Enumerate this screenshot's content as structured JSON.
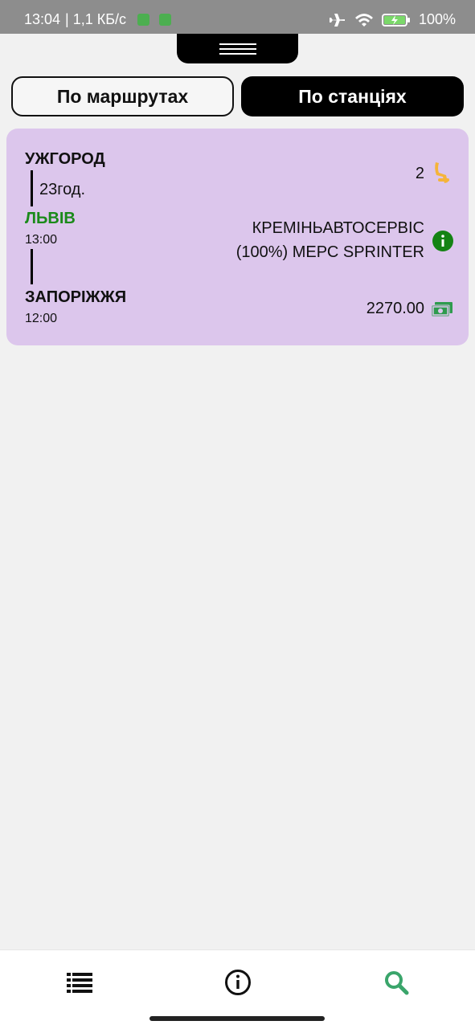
{
  "status_bar": {
    "time": "13:04",
    "speed": "| 1,1 КБ/с",
    "battery": "100%",
    "icons": [
      "app-icon",
      "app-icon",
      "airplane-icon",
      "wifi-icon",
      "battery-charging-icon"
    ]
  },
  "tabs": {
    "routes_label": "По маршрутах",
    "stations_label": "По станціях",
    "active": "stations"
  },
  "trip": {
    "origin": "УЖГОРОД",
    "duration": "23год.",
    "transfer_station": "ЛЬВІВ",
    "transfer_time": "13:00",
    "destination": "ЗАПОРІЖЖЯ",
    "destination_time": "12:00",
    "seats": "2",
    "carrier_line1": "КРЕМІНЬАВТОСЕРВІС",
    "carrier_line2": "(100%) МЕРС SPRINTER",
    "price": "2270.00",
    "colors": {
      "card": "#dcc6ec",
      "transfer": "#1a8a1a",
      "seat_icon": "#f5b43a",
      "money_icon": "#2e9b4e",
      "info_icon": "#148314"
    }
  },
  "bottom_nav": {
    "items": [
      "list-icon",
      "info-icon",
      "search-icon"
    ],
    "active": "search-icon",
    "active_color": "#3aa56b"
  }
}
